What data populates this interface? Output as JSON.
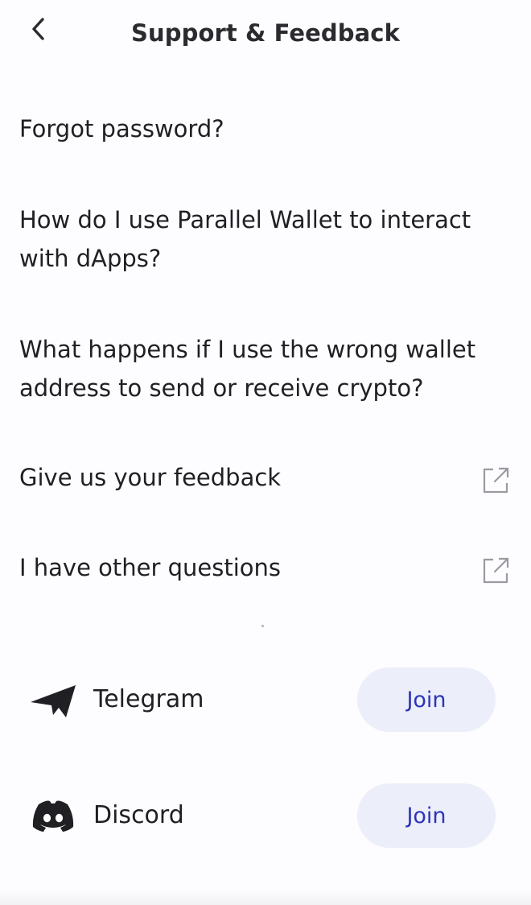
{
  "header": {
    "title": "Support & Feedback",
    "back_icon": "chevron-left-icon"
  },
  "faq": [
    {
      "label": "Forgot password?",
      "external": false
    },
    {
      "label": "How do I use Parallel Wallet to interact with dApps?",
      "external": false
    },
    {
      "label": "What happens if I use the wrong wallet address to send or receive crypto?",
      "external": false
    },
    {
      "label": "Give us your feedback",
      "external": true,
      "icon": "external-link-icon"
    },
    {
      "label": "I have other questions",
      "external": true,
      "icon": "external-link-icon"
    }
  ],
  "community": [
    {
      "name": "Telegram",
      "icon": "telegram-icon",
      "button_label": "Join"
    },
    {
      "name": "Discord",
      "icon": "discord-icon",
      "button_label": "Join"
    }
  ],
  "colors": {
    "join_bg": "#eceef9",
    "join_text": "#2d35b8",
    "text": "#1f1f24"
  }
}
